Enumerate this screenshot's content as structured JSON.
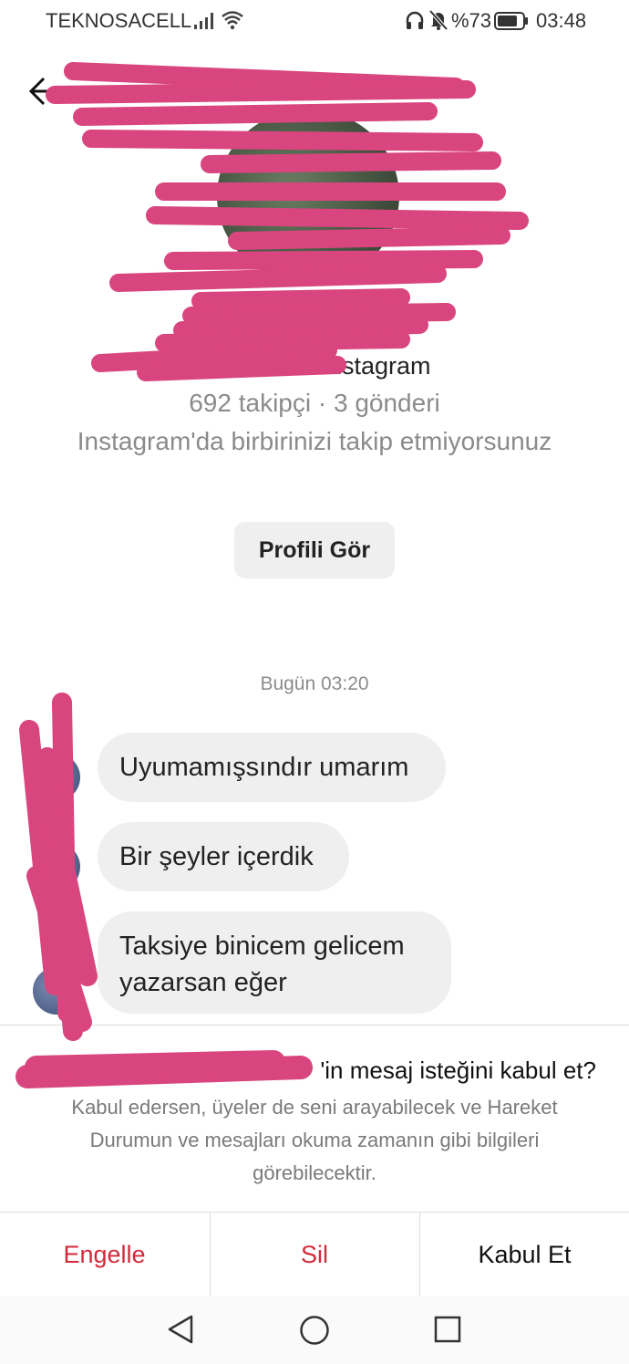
{
  "status_bar": {
    "carrier": "TEKNOSACELL",
    "battery_percent": "%73",
    "time": "03:48"
  },
  "profile": {
    "handle_suffix": "nstagram",
    "stats": "692 takipçi · 3 gönderi",
    "relation_note": "Instagram'da birbirinizi takip etmiyorsunuz",
    "view_profile_label": "Profili Gör"
  },
  "conversation": {
    "timestamp": "Bugün 03:20",
    "messages": [
      {
        "text": "Uyumamışsındır umarım"
      },
      {
        "text": "Bir şeyler içerdik"
      },
      {
        "text": "Taksiye binicem gelicem yazarsan eğer"
      }
    ]
  },
  "request": {
    "title_suffix": "'in mesaj isteğini kabul et?",
    "description": "Kabul edersen, üyeler de seni arayabilecek ve Hareket Durumun ve mesajları okuma zamanın gibi bilgileri görebilecektir.",
    "actions": {
      "block": "Engelle",
      "delete": "Sil",
      "accept": "Kabul Et"
    }
  },
  "colors": {
    "accent_red": "#d12a3a",
    "redaction_pink": "#d9457f",
    "bubble_bg": "#efefef"
  },
  "icons": [
    "signal-icon",
    "wifi-icon",
    "headphone-icon",
    "mute-icon",
    "battery-icon",
    "back-arrow-icon",
    "nav-back-icon",
    "nav-home-icon",
    "nav-recent-icon"
  ]
}
